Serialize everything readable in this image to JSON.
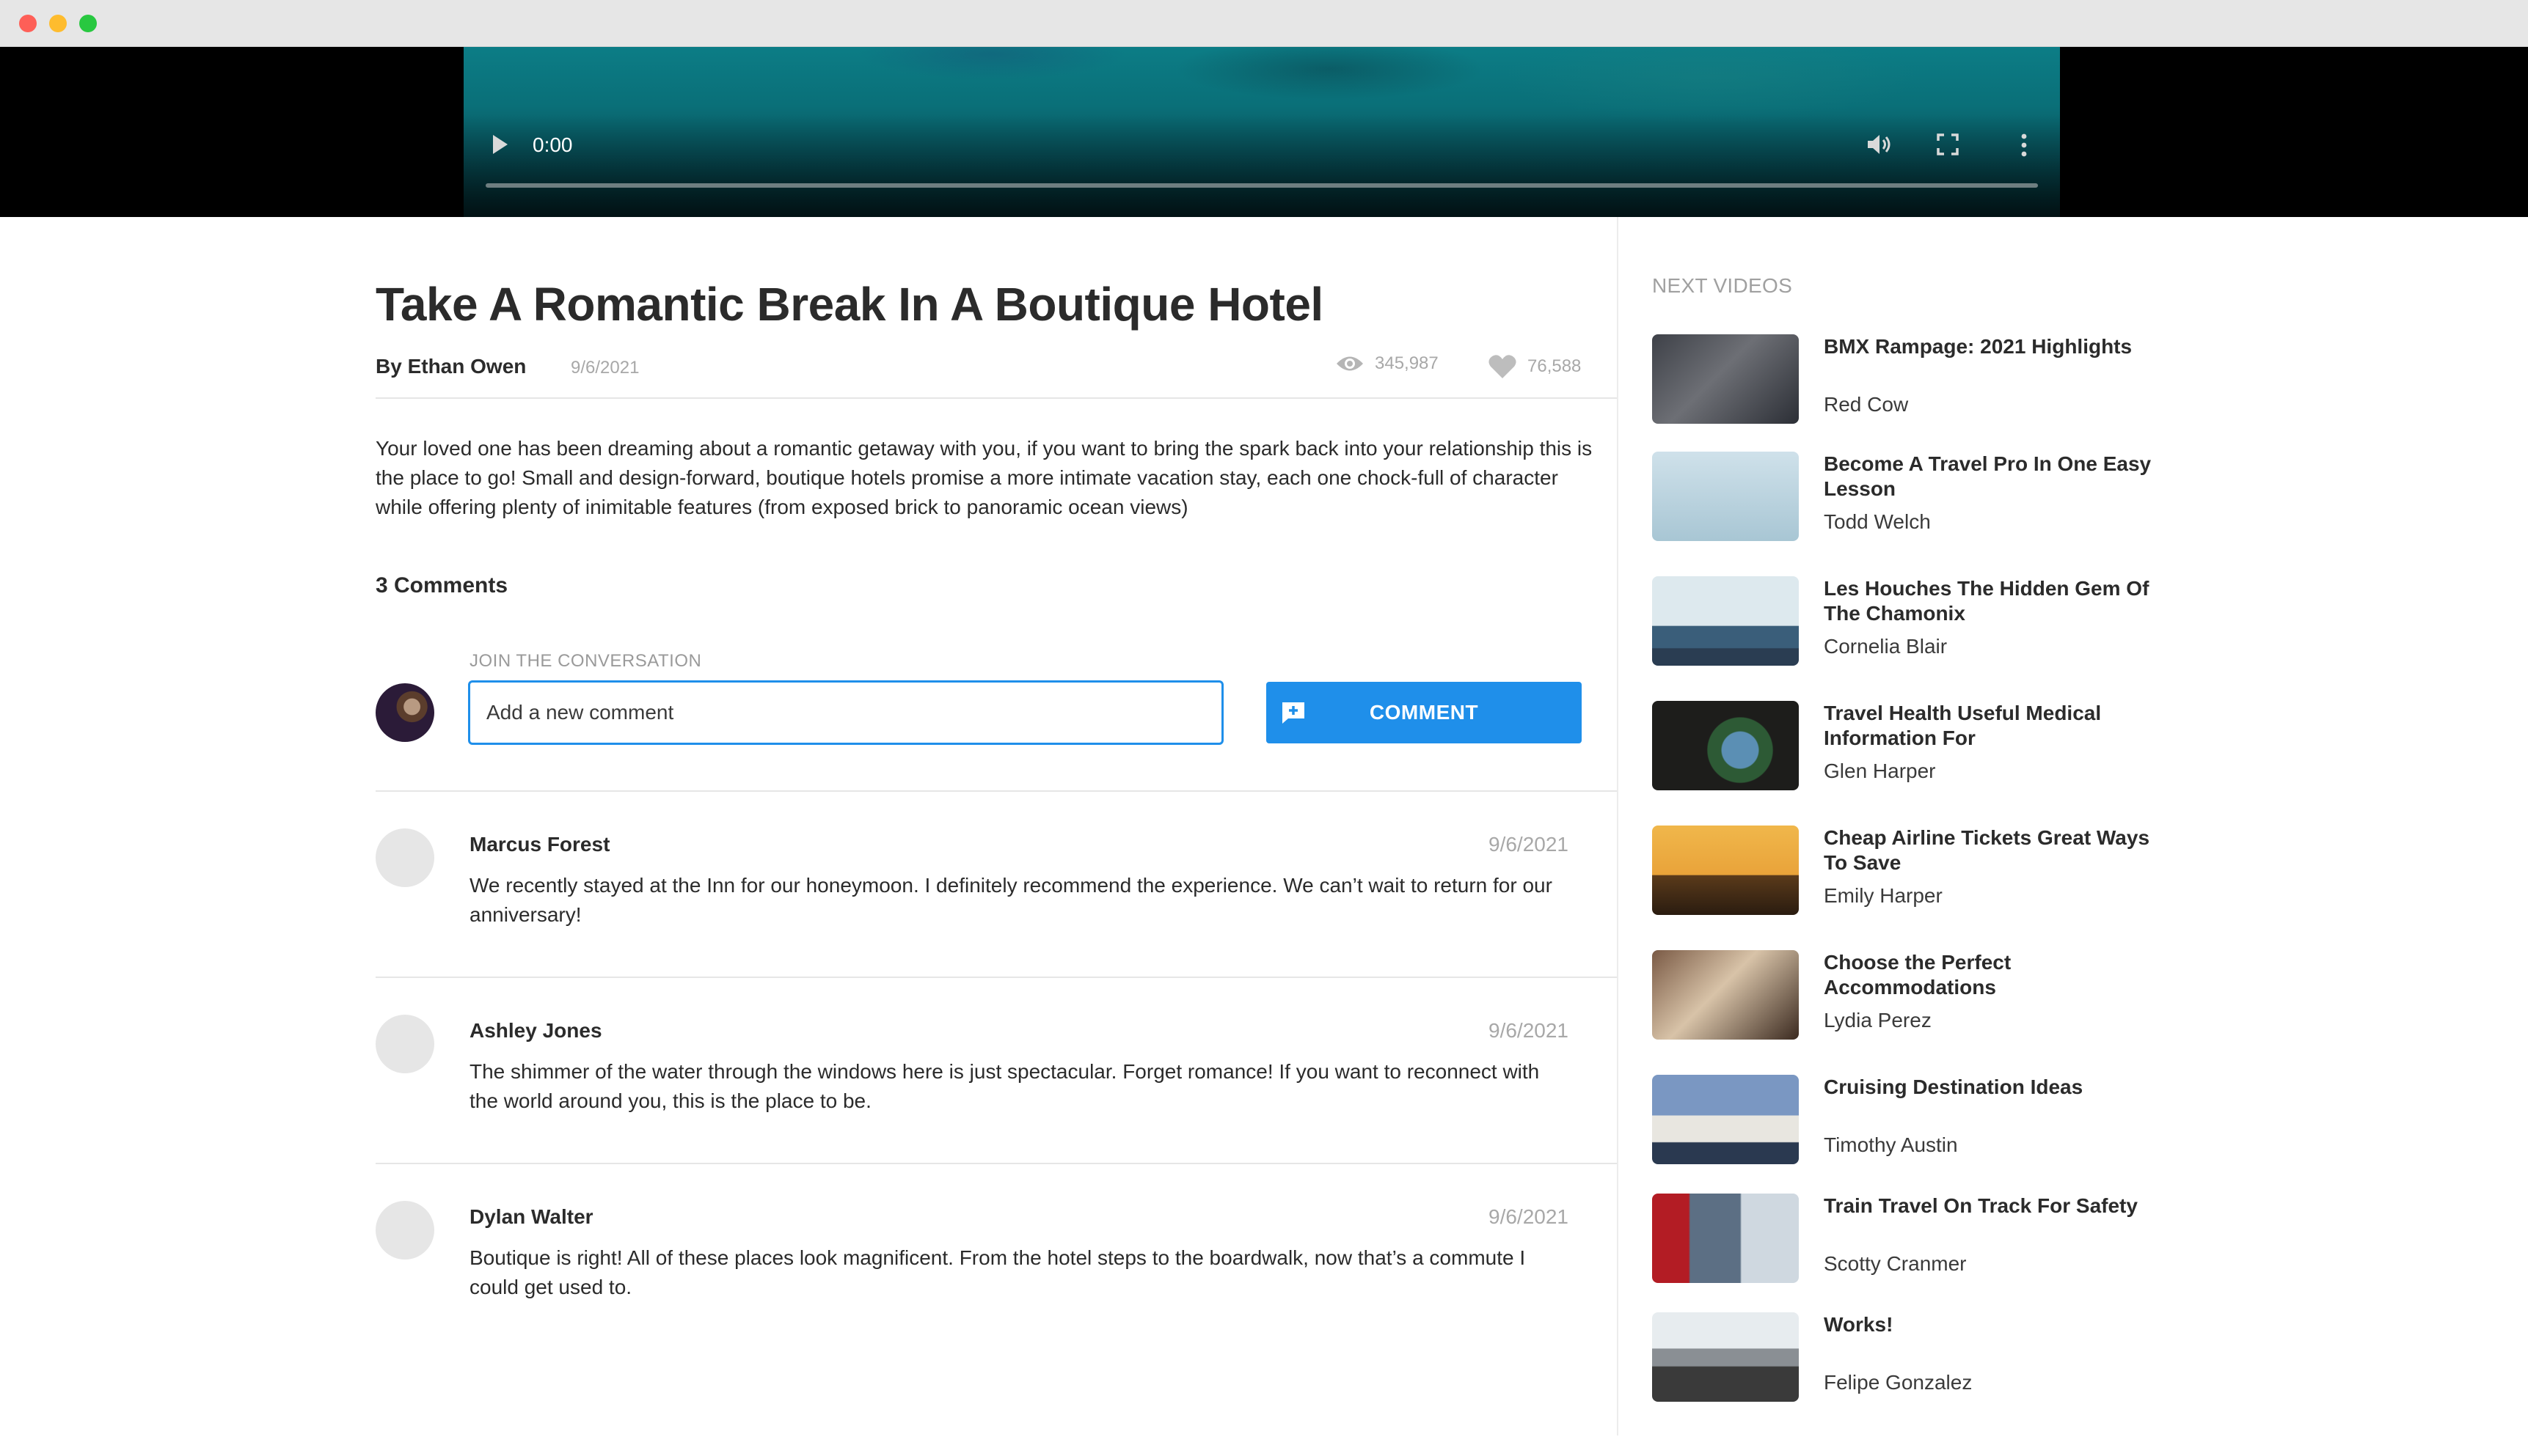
{
  "video": {
    "current_time": "0:00",
    "progress": 0
  },
  "article": {
    "title": "Take A Romantic Break In A Boutique Hotel",
    "author": "By Ethan Owen",
    "date": "9/6/2021",
    "views": "345,987",
    "likes": "76,588",
    "description": "Your loved one has been dreaming about a romantic getaway with you, if you want to bring the spark back into your relationship this is the place to go! Small and design-forward, boutique hotels promise a more intimate vacation stay, each one chock-full of character while offering plenty of inimitable features (from exposed brick to panoramic ocean views)"
  },
  "comments_section": {
    "count_label": "3 Comments",
    "join_label": "JOIN THE CONVERSATION",
    "input_placeholder": "Add a new comment",
    "input_value": "",
    "button_label": "COMMENT",
    "comments": [
      {
        "name": "Marcus Forest",
        "date": "9/6/2021",
        "text": "We recently stayed at the Inn for our honeymoon. I definitely recommend the experience. We can’t wait to return for our anniversary!"
      },
      {
        "name": "Ashley Jones",
        "date": "9/6/2021",
        "text": "The shimmer of the water through the windows here is just spectacular. Forget romance! If you want to reconnect with the world around you, this is the place to be."
      },
      {
        "name": "Dylan Walter",
        "date": "9/6/2021",
        "text": "Boutique is right! All of these places look magnificent. From the hotel steps to the boardwalk, now that’s a commute I could get used to."
      }
    ]
  },
  "next_videos": {
    "heading": "NEXT VIDEOS",
    "items": [
      {
        "title": "BMX Rampage: 2021 Highlights",
        "author": "Red Cow"
      },
      {
        "title": "Become A Travel Pro In One Easy Lesson",
        "author": "Todd Welch"
      },
      {
        "title": "Les Houches The Hidden Gem Of The Chamonix",
        "author": "Cornelia Blair"
      },
      {
        "title": "Travel Health Useful Medical Information For",
        "author": "Glen Harper"
      },
      {
        "title": "Cheap Airline Tickets Great Ways To Save",
        "author": "Emily Harper"
      },
      {
        "title": "Choose the Perfect Accommodations",
        "author": "Lydia Perez"
      },
      {
        "title": "Cruising Destination Ideas",
        "author": "Timothy Austin"
      },
      {
        "title": "Train Travel On Track For Safety",
        "author": "Scotty Cranmer"
      },
      {
        "title": "Works!",
        "author": "Felipe Gonzalez"
      }
    ]
  },
  "colors": {
    "accent": "#1f8fea",
    "muted_text": "#a8a8a8",
    "divider": "#e6e6e6"
  }
}
